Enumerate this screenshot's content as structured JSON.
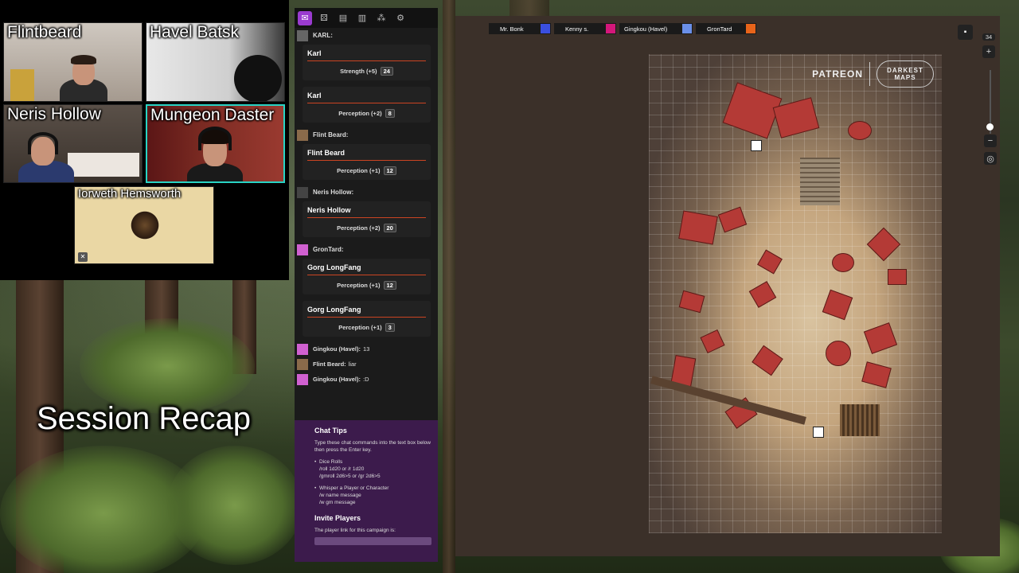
{
  "overlay": {
    "recap_title": "Session Recap"
  },
  "video_tiles": [
    {
      "name": "Flintbeard"
    },
    {
      "name": "Havel Batsk"
    },
    {
      "name": "Neris Hollow"
    },
    {
      "name": "Mungeon Daster"
    },
    {
      "name": "Iorweth Hemsworth"
    }
  ],
  "chat": {
    "tabs": [
      "chat-icon",
      "dice-icon",
      "journal-icon",
      "compendium-icon",
      "network-icon",
      "settings-icon"
    ],
    "messages": [
      {
        "sender": "KARL:",
        "card_name": "Karl",
        "check": "Strength (+5)",
        "result": "24"
      },
      {
        "card_name": "Karl",
        "check": "Perception (+2)",
        "result": "8"
      },
      {
        "sender": "Flint Beard:",
        "card_name": "Flint Beard",
        "check": "Perception (+1)",
        "result": "12"
      },
      {
        "sender": "Neris Hollow:",
        "card_name": "Neris Hollow",
        "check": "Perception (+2)",
        "result": "20"
      },
      {
        "sender": "GronTard:",
        "card_name": "Gorg LongFang",
        "check": "Perception (+1)",
        "result": "12"
      },
      {
        "card_name": "Gorg LongFang",
        "check": "Perception (+1)",
        "result": "3"
      }
    ],
    "lines": [
      {
        "sender": "Gingkou (Havel):",
        "text": "13"
      },
      {
        "sender": "Flint Beard:",
        "text": "liar"
      },
      {
        "sender": "Gingkou (Havel):",
        "text": ":D"
      }
    ],
    "tips": {
      "title": "Chat Tips",
      "intro": "Type these chat commands into the text box below then press the Enter key.",
      "dice_label": "Dice Rolls",
      "dice_line1": "/roll 1d20 or /r 1d20",
      "dice_line2": "/gmroll 2d6>5 or /gr 2d6>5",
      "whisper_label": "Whisper a Player or Character",
      "whisper_line1": "/w name message",
      "whisper_line2": "/w gm message",
      "invite_title": "Invite Players",
      "invite_text": "The player link for this campaign is:"
    }
  },
  "players": [
    {
      "name": "Mr. Bonk",
      "color": "#3a4fe0"
    },
    {
      "name": "Kenny s.",
      "color": "#d4177a"
    },
    {
      "name": "Gingkou (Havel)",
      "color": "#6a8fe8"
    },
    {
      "name": "GronTard",
      "color": "#e8641a"
    }
  ],
  "map": {
    "watermark_brand": "PATREON",
    "watermark_logo": "DARKEST MAPS"
  },
  "zoom": {
    "level": "34",
    "plus": "+",
    "minus": "−"
  }
}
